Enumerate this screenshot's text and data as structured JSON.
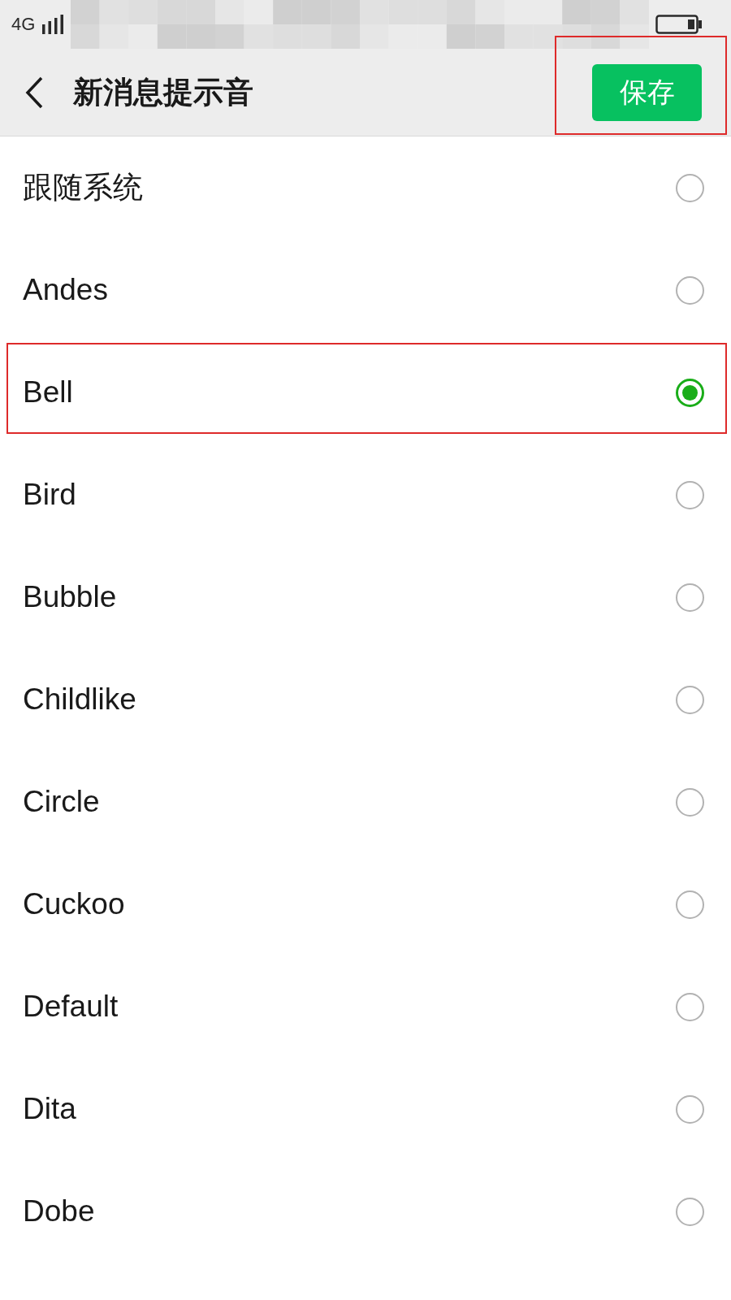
{
  "status_bar": {
    "network": "4G"
  },
  "header": {
    "title": "新消息提示音",
    "save_button": {
      "label": "保存",
      "highlighted": true
    }
  },
  "options": [
    {
      "label": "跟随系统",
      "selected": false,
      "highlighted": false
    },
    {
      "label": "Andes",
      "selected": false,
      "highlighted": false
    },
    {
      "label": "Bell",
      "selected": true,
      "highlighted": true
    },
    {
      "label": "Bird",
      "selected": false,
      "highlighted": false
    },
    {
      "label": "Bubble",
      "selected": false,
      "highlighted": false
    },
    {
      "label": "Childlike",
      "selected": false,
      "highlighted": false
    },
    {
      "label": "Circle",
      "selected": false,
      "highlighted": false
    },
    {
      "label": "Cuckoo",
      "selected": false,
      "highlighted": false
    },
    {
      "label": "Default",
      "selected": false,
      "highlighted": false
    },
    {
      "label": "Dita",
      "selected": false,
      "highlighted": false
    },
    {
      "label": "Dobe",
      "selected": false,
      "highlighted": false
    }
  ]
}
